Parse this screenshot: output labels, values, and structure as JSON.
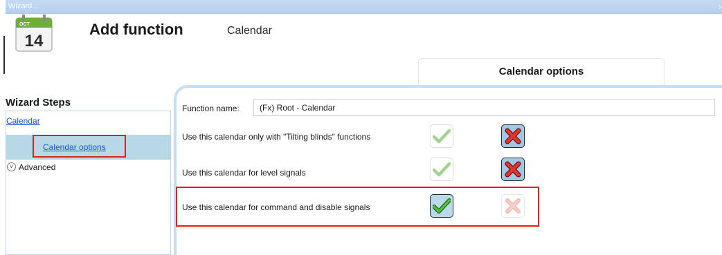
{
  "window": {
    "title": "Wizard...",
    "close_glyph": "›"
  },
  "header": {
    "icon": {
      "name": "calendar-icon",
      "month": "OCT",
      "day": "14"
    },
    "title": "Add function",
    "subtitle": "Calendar"
  },
  "tab": {
    "label": "Calendar options"
  },
  "sidebar": {
    "title": "Wizard Steps",
    "step": "Calendar",
    "substep": "Calendar options",
    "advanced": {
      "toggle_glyph": "˅",
      "label": "Advanced"
    }
  },
  "form": {
    "function_name": {
      "label": "Function name:",
      "value": "(Fx) Root - Calendar"
    },
    "options": [
      {
        "label": "Use this calendar only with \"Tilting blinds\" functions",
        "selected": "no"
      },
      {
        "label": "Use this calendar for level signals",
        "selected": "no"
      },
      {
        "label": "Use this calendar for command and disable signals",
        "selected": "yes"
      }
    ]
  },
  "colors": {
    "accent_blue": "#c7def2",
    "selection": "#b7d9e6",
    "highlight_red": "#e02020",
    "link": "#1a55c8"
  }
}
